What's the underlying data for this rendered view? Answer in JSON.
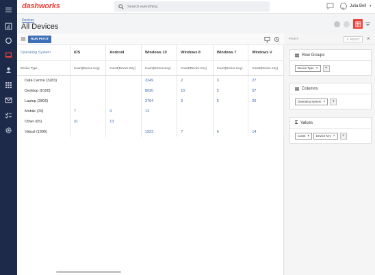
{
  "header": {
    "logo_prefix": "dash",
    "logo_suffix": "works",
    "search_placeholder": "Search everything",
    "user_name": "Julia Bell"
  },
  "page": {
    "breadcrumb": "Devices",
    "title": "All Devices"
  },
  "toolbar": {
    "run_pivot": "RUN PIVOT"
  },
  "grid": {
    "row_header": "Operating System",
    "row_subheader": "Device Type",
    "columns": [
      {
        "label": "iOS",
        "sub": "Count(Device Key)"
      },
      {
        "label": "Android",
        "sub": "Count(Device Key)"
      },
      {
        "label": "Windows 10",
        "sub": "Count(Device Key)"
      },
      {
        "label": "Windows 8",
        "sub": "Count(Device Key)"
      },
      {
        "label": "Windows 7",
        "sub": "Count(Device Key)"
      },
      {
        "label": "Windows V",
        "sub": "Count(Device Key)"
      }
    ],
    "rows": [
      {
        "label": "Data Centre  (3283)",
        "cells": [
          "",
          "",
          "3249",
          "2",
          "3",
          "27"
        ]
      },
      {
        "label": "Desktop  (8100)",
        "cells": [
          "",
          "",
          "8020",
          "10",
          "5",
          "57"
        ]
      },
      {
        "label": "Laptop  (3806)",
        "cells": [
          "",
          "",
          "3764",
          "9",
          "5",
          "26"
        ]
      },
      {
        "label": "Mobile  (29)",
        "cells": [
          "7",
          "9",
          "13",
          "",
          "",
          ""
        ]
      },
      {
        "label": "Other  (65)",
        "cells": [
          "31",
          "13",
          "",
          "",
          "",
          ""
        ]
      },
      {
        "label": "Virtual  (1996)",
        "cells": [
          "",
          "",
          "1923",
          "7",
          "6",
          "14"
        ]
      }
    ]
  },
  "pivot": {
    "title": "PIVOT",
    "reset_label": "RESET",
    "row_groups": {
      "title": "Row Groups",
      "chips": [
        "Device Type"
      ]
    },
    "columns": {
      "title": "Columns",
      "chips": [
        "Operating System"
      ]
    },
    "values": {
      "title": "Values",
      "agg": "Count",
      "field": "Device Key"
    }
  },
  "colors": {
    "accent": "#e8433b",
    "nav": "#1e2a4a",
    "primary": "#3d6fb6",
    "link": "#3a66b0"
  }
}
